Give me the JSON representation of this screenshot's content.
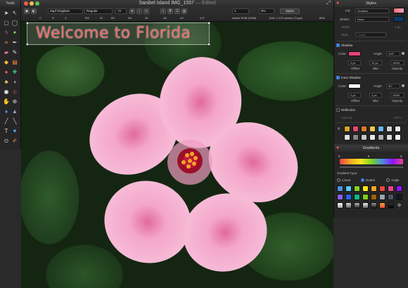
{
  "window": {
    "title": "Sanibel Island IMG_1557",
    "status": "— Edited",
    "colors": {
      "close": "#ee5a52",
      "minimize": "#f4be4f",
      "zoom": "#5fc453"
    }
  },
  "toolbar": {
    "font": "Zapf Dingbats",
    "weight": "Regular",
    "size": "72",
    "paragraph": "1",
    "tracking": "0%",
    "styles_button": "Styles",
    "colorspace": "Adobe RGB (1998)",
    "dimensions": "1261 x 1170 pixels (72 ppi)",
    "zoom": "80%",
    "metrics": [
      "C",
      "S",
      "X",
      "783",
      "W",
      "8X",
      "AX",
      "AY",
      "ΔX",
      "ΔY",
      "0.0°"
    ]
  },
  "tools": {
    "title": "Tools"
  },
  "canvas": {
    "text": "Welcome to Florida",
    "colors": {
      "text": "#e96e6e",
      "petal": "#f4a6c9",
      "center": "#9b0f2a",
      "stamen": "#f5a623"
    }
  },
  "styles_panel": {
    "title": "Styles",
    "fill_label": "Fill:",
    "fill_value": "Gradient",
    "stroke_label": "Stroke:",
    "stroke_value": "None",
    "width_label": "Width:",
    "width_value": "1 px",
    "style_label": "Style:",
    "style_value": "Center",
    "shadow_label": "Shadow",
    "shadow_color_label": "Color:",
    "shadow_angle_label": "Angle:",
    "shadow_angle": "315°",
    "shadow_offset": "0 px",
    "shadow_blur": "12 px",
    "shadow_opacity": "100%",
    "offset_label": "Offset",
    "blur_label": "Blur",
    "opacity_label": "Opacity",
    "inner_shadow_label": "Inner Shadow",
    "inner_color_label": "Color:",
    "inner_angle_label": "Angle:",
    "inner_angle": "90°",
    "inner_offset": "2 px",
    "inner_blur": "2 px",
    "inner_opacity": "100%",
    "reflection_label": "Reflection",
    "reflection_opacity_label": "Opacity",
    "reflection_opacity": "100%",
    "colors": {
      "shadow": "#e8457a",
      "inner": "#ffffff"
    }
  },
  "gradients_panel": {
    "title": "Gradients",
    "type_label": "Gradient Type:",
    "linear": "Linear",
    "radial": "Radial",
    "angle": "Angle"
  }
}
